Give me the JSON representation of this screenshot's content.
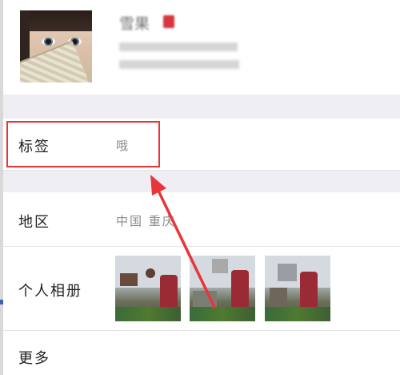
{
  "profile": {
    "name": "雪果"
  },
  "rows": {
    "tag": {
      "label": "标签",
      "value": "哦"
    },
    "region": {
      "label": "地区",
      "value": "中国  重庆"
    },
    "album": {
      "label": "个人相册"
    },
    "more": {
      "label": "更多"
    }
  },
  "colors": {
    "highlight": "#e8353c",
    "arrow": "#e8353c",
    "section_gap": "#efeff3",
    "label_text": "#1f1f1f",
    "value_text": "#8c8c8c"
  },
  "icons": {
    "annotation": "red-arrow"
  }
}
